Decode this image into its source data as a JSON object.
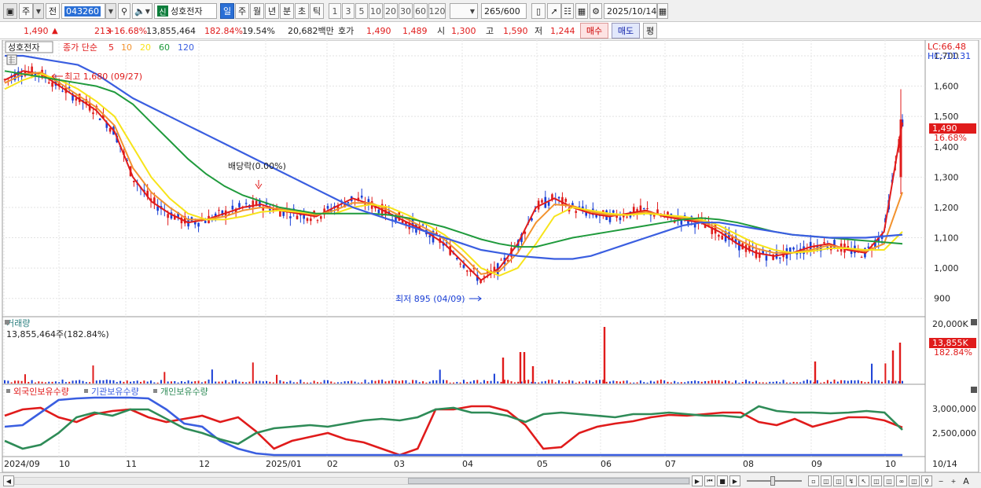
{
  "toolbar": {
    "mode_label": "주",
    "prev_label": "전",
    "stock_code": "043260",
    "stock_badge": "신",
    "stock_name": "성호전자",
    "period_buttons": [
      "일",
      "주",
      "월",
      "년",
      "분",
      "초",
      "틱"
    ],
    "period_selected": "일",
    "interval_buttons": [
      "1",
      "3",
      "5",
      "10",
      "20",
      "30",
      "60",
      "120"
    ],
    "count_value": "265",
    "count_max": "/600",
    "date_value": "2025/10/14"
  },
  "inforow": {
    "price": "1,490",
    "change": "213",
    "change_pct": "+16.68%",
    "volume": "13,855,464",
    "vol_ratio": "182.84%",
    "turnover": "19.54%",
    "amount": "20,682백만",
    "hoga_label": "호가",
    "hoga_ask": "1,490",
    "hoga_bid": "1,489",
    "open_label": "시",
    "open": "1,300",
    "high_label": "고",
    "high": "1,590",
    "low_label": "저",
    "low": "1,244",
    "buy_label": "매수",
    "sell_label": "매도",
    "pyeong_label": "평"
  },
  "price_panel": {
    "name_tag": "성호전자",
    "legend_prefix": "종가 단순",
    "ma_labels": [
      "5",
      "10",
      "20",
      "60",
      "120"
    ],
    "ma_colors": [
      "#e01b1b",
      "#f2922d",
      "#f7e41a",
      "#1f9a3c",
      "#3a5ee0"
    ],
    "lc_label": "LC:66.48",
    "hc_label": "HC:-11.31",
    "current_price_tag": "1,490",
    "current_pct_tag": "16.68%",
    "annotation_high": "최고 1,680 (09/27)",
    "annotation_low": "최저 895 (04/09)",
    "annotation_dividend": "배당락(0.00%)"
  },
  "volume_panel": {
    "title": "거래량",
    "value_text": "13,855,464주(182.84%)",
    "axis_top": "20,000K",
    "current_tag": "13,855K",
    "current_pct_tag": "182.84%"
  },
  "holding_panel": {
    "legend": [
      "외국인보유수량",
      "기관보유수량",
      "개인보유수량"
    ],
    "legend_colors": [
      "#e01b1b",
      "#3a5ee0",
      "#2e8b57"
    ],
    "axis_labels": [
      "3,000,000",
      "2,500,000"
    ]
  },
  "xaxis": {
    "labels": [
      "2024/09",
      "10",
      "11",
      "12",
      "2025/01",
      "02",
      "03",
      "04",
      "05",
      "06",
      "07",
      "08",
      "09",
      "10"
    ],
    "end_label": "10/14"
  },
  "chart_data": [
    {
      "type": "line",
      "title": "",
      "ylim": [
        850,
        1700
      ],
      "yticks": [
        900,
        1000,
        1100,
        1200,
        1300,
        1400,
        1500,
        1600,
        1700
      ],
      "series": [
        {
          "name": "5",
          "values": [
            1620,
            1650,
            1640,
            1600,
            1560,
            1520,
            1450,
            1300,
            1220,
            1180,
            1150,
            1160,
            1180,
            1200,
            1210,
            1190,
            1180,
            1170,
            1200,
            1230,
            1210,
            1180,
            1150,
            1120,
            1080,
            1020,
            960,
            1000,
            1080,
            1200,
            1230,
            1200,
            1180,
            1170,
            1180,
            1190,
            1170,
            1160,
            1150,
            1120,
            1080,
            1050,
            1040,
            1050,
            1070,
            1080,
            1060,
            1050,
            1120,
            1480
          ]
        },
        {
          "name": "10",
          "values": [
            1610,
            1640,
            1645,
            1610,
            1570,
            1530,
            1470,
            1330,
            1250,
            1200,
            1160,
            1160,
            1170,
            1190,
            1200,
            1195,
            1185,
            1175,
            1190,
            1215,
            1215,
            1190,
            1160,
            1130,
            1095,
            1040,
            980,
            990,
            1050,
            1150,
            1210,
            1205,
            1185,
            1175,
            1175,
            1185,
            1175,
            1165,
            1155,
            1130,
            1095,
            1065,
            1050,
            1050,
            1060,
            1075,
            1065,
            1055,
            1080,
            1250
          ]
        },
        {
          "name": "20",
          "values": [
            1590,
            1620,
            1640,
            1620,
            1590,
            1550,
            1500,
            1400,
            1300,
            1230,
            1180,
            1160,
            1160,
            1170,
            1185,
            1190,
            1185,
            1180,
            1180,
            1200,
            1210,
            1200,
            1175,
            1145,
            1110,
            1060,
            1000,
            975,
            1000,
            1080,
            1170,
            1200,
            1190,
            1180,
            1175,
            1180,
            1175,
            1170,
            1160,
            1140,
            1110,
            1080,
            1060,
            1050,
            1055,
            1065,
            1065,
            1060,
            1060,
            1120
          ]
        },
        {
          "name": "60",
          "values": [
            1650,
            1640,
            1630,
            1620,
            1610,
            1600,
            1580,
            1540,
            1480,
            1420,
            1360,
            1310,
            1270,
            1240,
            1220,
            1200,
            1190,
            1180,
            1180,
            1180,
            1180,
            1175,
            1165,
            1150,
            1135,
            1115,
            1095,
            1080,
            1070,
            1070,
            1085,
            1100,
            1110,
            1120,
            1130,
            1140,
            1150,
            1160,
            1165,
            1160,
            1150,
            1135,
            1120,
            1110,
            1105,
            1100,
            1095,
            1090,
            1085,
            1080
          ]
        },
        {
          "name": "120",
          "values": [
            1700,
            1700,
            1690,
            1680,
            1670,
            1640,
            1600,
            1560,
            1530,
            1500,
            1470,
            1440,
            1410,
            1380,
            1350,
            1320,
            1290,
            1260,
            1230,
            1200,
            1180,
            1160,
            1140,
            1120,
            1100,
            1080,
            1060,
            1050,
            1040,
            1035,
            1030,
            1030,
            1040,
            1060,
            1080,
            1100,
            1120,
            1140,
            1150,
            1150,
            1140,
            1130,
            1120,
            1110,
            1105,
            1100,
            1100,
            1100,
            1105,
            1110
          ]
        }
      ]
    }
  ]
}
